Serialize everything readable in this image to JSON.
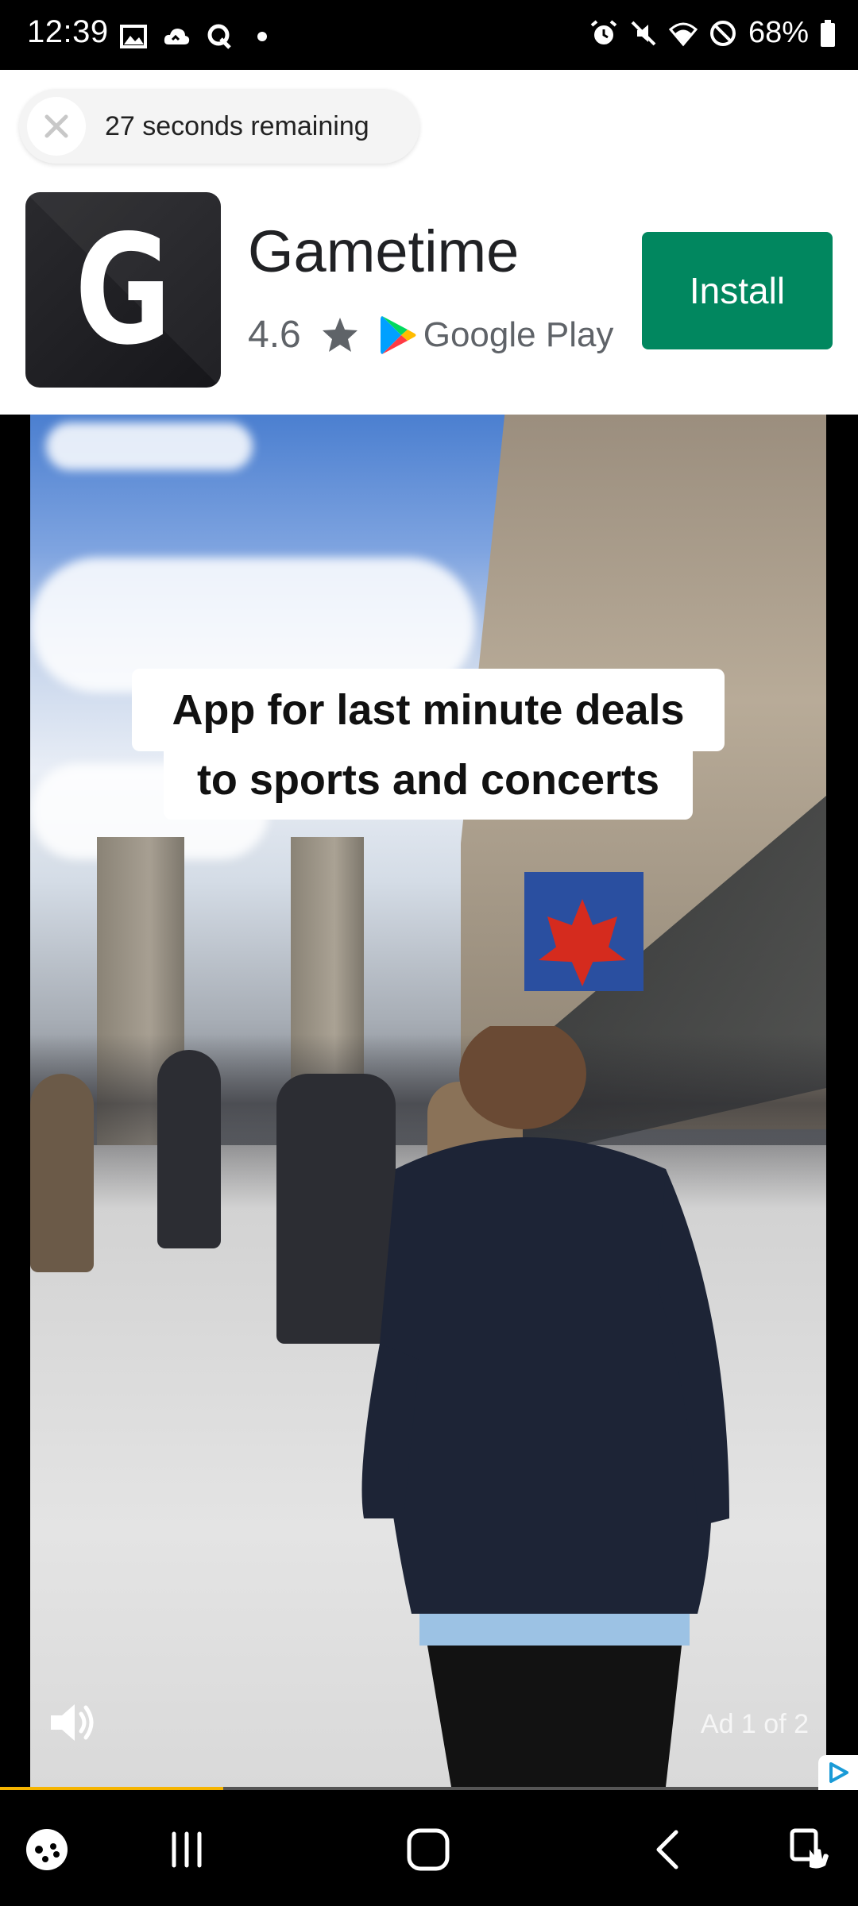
{
  "status_bar": {
    "time": "12:39",
    "battery": "68%",
    "left_icons": [
      "gallery-icon",
      "cloud-icon",
      "q-icon",
      "dot-icon"
    ],
    "right_icons": [
      "alarm-icon",
      "mute-icon",
      "wifi-icon",
      "do-not-disturb-icon",
      "battery-icon"
    ]
  },
  "ad": {
    "timer_text": "27 seconds remaining",
    "app_icon_letter": "G",
    "app_name": "Gametime",
    "rating": "4.6",
    "store": "Google Play",
    "install_label": "Install",
    "accent_color": "#01875f"
  },
  "video": {
    "caption_line_1": "App for last minute deals",
    "caption_line_2": "to sports and concerts",
    "ad_counter": "Ad 1 of 2",
    "progress": 0.26
  },
  "nav_bar": {
    "items": [
      "game-launcher-icon",
      "recent-apps-icon",
      "home-icon",
      "back-icon",
      "accessibility-icon"
    ]
  }
}
